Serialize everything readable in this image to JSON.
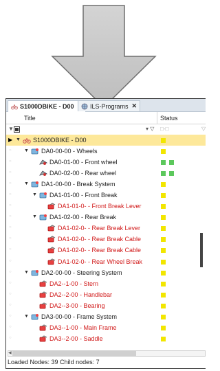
{
  "tabs": [
    {
      "label": "S1000DBIKE - D00",
      "icon": "bike-icon",
      "active": true
    },
    {
      "label": "ILS-Programs",
      "icon": "globe-icon",
      "active": false
    }
  ],
  "columns": {
    "title": "Title",
    "status": "Status"
  },
  "rows": [
    {
      "label": "S1000DBIKE - D00",
      "type": "root",
      "selected": true,
      "depth": 0,
      "expand": "▼",
      "status": [
        "yellow"
      ]
    },
    {
      "label": "DA0-00-00 - Wheels",
      "type": "folder",
      "depth": 1,
      "expand": "▼",
      "status": [
        "yellow"
      ]
    },
    {
      "label": "DA0-01-00 - Front wheel",
      "type": "part",
      "depth": 2,
      "status": [
        "green",
        "green"
      ]
    },
    {
      "label": "DA0-02-00 - Rear wheel",
      "type": "part",
      "depth": 2,
      "status": [
        "green",
        "green"
      ]
    },
    {
      "label": "DA1-00-00 - Break System",
      "type": "folder",
      "depth": 1,
      "expand": "▼",
      "status": [
        "yellow"
      ]
    },
    {
      "label": "DA1-01-00 - Front Break",
      "type": "folder",
      "depth": 2,
      "expand": "▼",
      "status": [
        "yellow"
      ]
    },
    {
      "label": "DA1-01-0- - Front Break Lever",
      "type": "red",
      "depth": 3,
      "status": [
        "yellow"
      ]
    },
    {
      "label": "DA1-02-00 - Rear Break",
      "type": "folder",
      "depth": 2,
      "expand": "▼",
      "status": [
        "yellow"
      ]
    },
    {
      "label": "DA1-02-0- - Rear Break Lever",
      "type": "red",
      "depth": 3,
      "status": [
        "yellow"
      ]
    },
    {
      "label": "DA1-02-0- - Rear Break Cable",
      "type": "red",
      "depth": 3,
      "status": [
        "yellow"
      ]
    },
    {
      "label": "DA1-02-0- - Rear Break Cable",
      "type": "red",
      "depth": 3,
      "status": [
        "yellow"
      ]
    },
    {
      "label": "DA1-02-0- - Rear Wheel Break",
      "type": "red",
      "depth": 3,
      "status": [
        "yellow"
      ]
    },
    {
      "label": "DA2-00-00 - Steering System",
      "type": "folder",
      "depth": 1,
      "expand": "▼",
      "status": [
        "yellow"
      ]
    },
    {
      "label": "DA2--1-00 - Stern",
      "type": "red",
      "depth": 2,
      "status": [
        "yellow"
      ]
    },
    {
      "label": "DA2--2-00 - Handlebar",
      "type": "red",
      "depth": 2,
      "status": [
        "yellow"
      ]
    },
    {
      "label": "DA2--3-00 - Bearing",
      "type": "red",
      "depth": 2,
      "status": [
        "yellow"
      ]
    },
    {
      "label": "DA3-00-00 - Frame System",
      "type": "folder",
      "depth": 1,
      "expand": "▼",
      "status": [
        "yellow"
      ]
    },
    {
      "label": "DA3--1-00 - Main Frame",
      "type": "red",
      "depth": 2,
      "status": [
        "yellow"
      ]
    },
    {
      "label": "DA3--2-00 - Saddle",
      "type": "red",
      "depth": 2,
      "status": [
        "yellow"
      ]
    }
  ],
  "status_bar": "Loaded Nodes: 39  Child nodes: 7",
  "colors": {
    "selected_row": "#fde89a",
    "status_yellow": "#f2e600",
    "status_green": "#5cc85c",
    "red_text": "#d11a1a"
  }
}
